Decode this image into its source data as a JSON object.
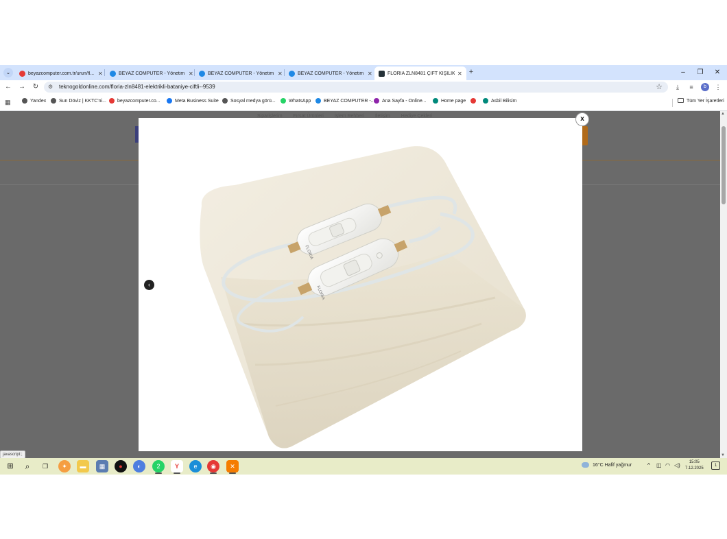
{
  "browser": {
    "tabs": [
      {
        "title": "beyazcomputer.com.tr/urun/fl...",
        "favicon_color": "#e53935"
      },
      {
        "title": "BEYAZ COMPUTER - Yönetim P...",
        "favicon_color": "#1e88e5"
      },
      {
        "title": "BEYAZ COMPUTER - Yönetim P...",
        "favicon_color": "#1e88e5"
      },
      {
        "title": "BEYAZ COMPUTER - Yönetim P...",
        "favicon_color": "#1e88e5"
      },
      {
        "title": "FLORIA ZLN8481 ÇİFT KİŞİLİK E...",
        "favicon_color": "#263238"
      }
    ],
    "url": "teknogoldonline.com/floria-zln8481-elektrikli-bataniye-ciftli--9539",
    "bookmarks": [
      {
        "label": "Yandex",
        "favicon_color": "#555555"
      },
      {
        "label": "Sun Döviz | KKTC'ni...",
        "favicon_color": "#555555"
      },
      {
        "label": "beyazcomputer.co...",
        "favicon_color": "#e53935"
      },
      {
        "label": "Meta Business Suite",
        "favicon_color": "#1877f2"
      },
      {
        "label": "Sosyal medya görü...",
        "favicon_color": "#555555"
      },
      {
        "label": "WhatsApp",
        "favicon_color": "#25d366"
      },
      {
        "label": "BEYAZ COMPUTER -...",
        "favicon_color": "#1e88e5"
      },
      {
        "label": "Ana Sayfa - Online...",
        "favicon_color": "#8e24aa"
      },
      {
        "label": "Home page",
        "favicon_color": "#00897b"
      },
      {
        "label": "",
        "favicon_color": "#e53935"
      },
      {
        "label": "Asbil Bilisim",
        "favicon_color": "#00897b"
      }
    ],
    "all_bookmarks_label": "Tüm Yer İşaretleri",
    "profile_initial": "b",
    "status_text": "javascript:;"
  },
  "page": {
    "nav_items": [
      "Siparişlerim",
      "Fırsat Ürünleri",
      "İşlem Rehberi",
      "İletişim",
      "Hediye Çekleri"
    ],
    "modal": {
      "close_label": "x",
      "product_brand_mark": "FLORIA"
    }
  },
  "taskbar": {
    "weather": "16°C  Hafif yağmur",
    "time": "15:05",
    "date": "7.12.2025",
    "whatsapp_badge": "2",
    "notification_count": "1"
  }
}
